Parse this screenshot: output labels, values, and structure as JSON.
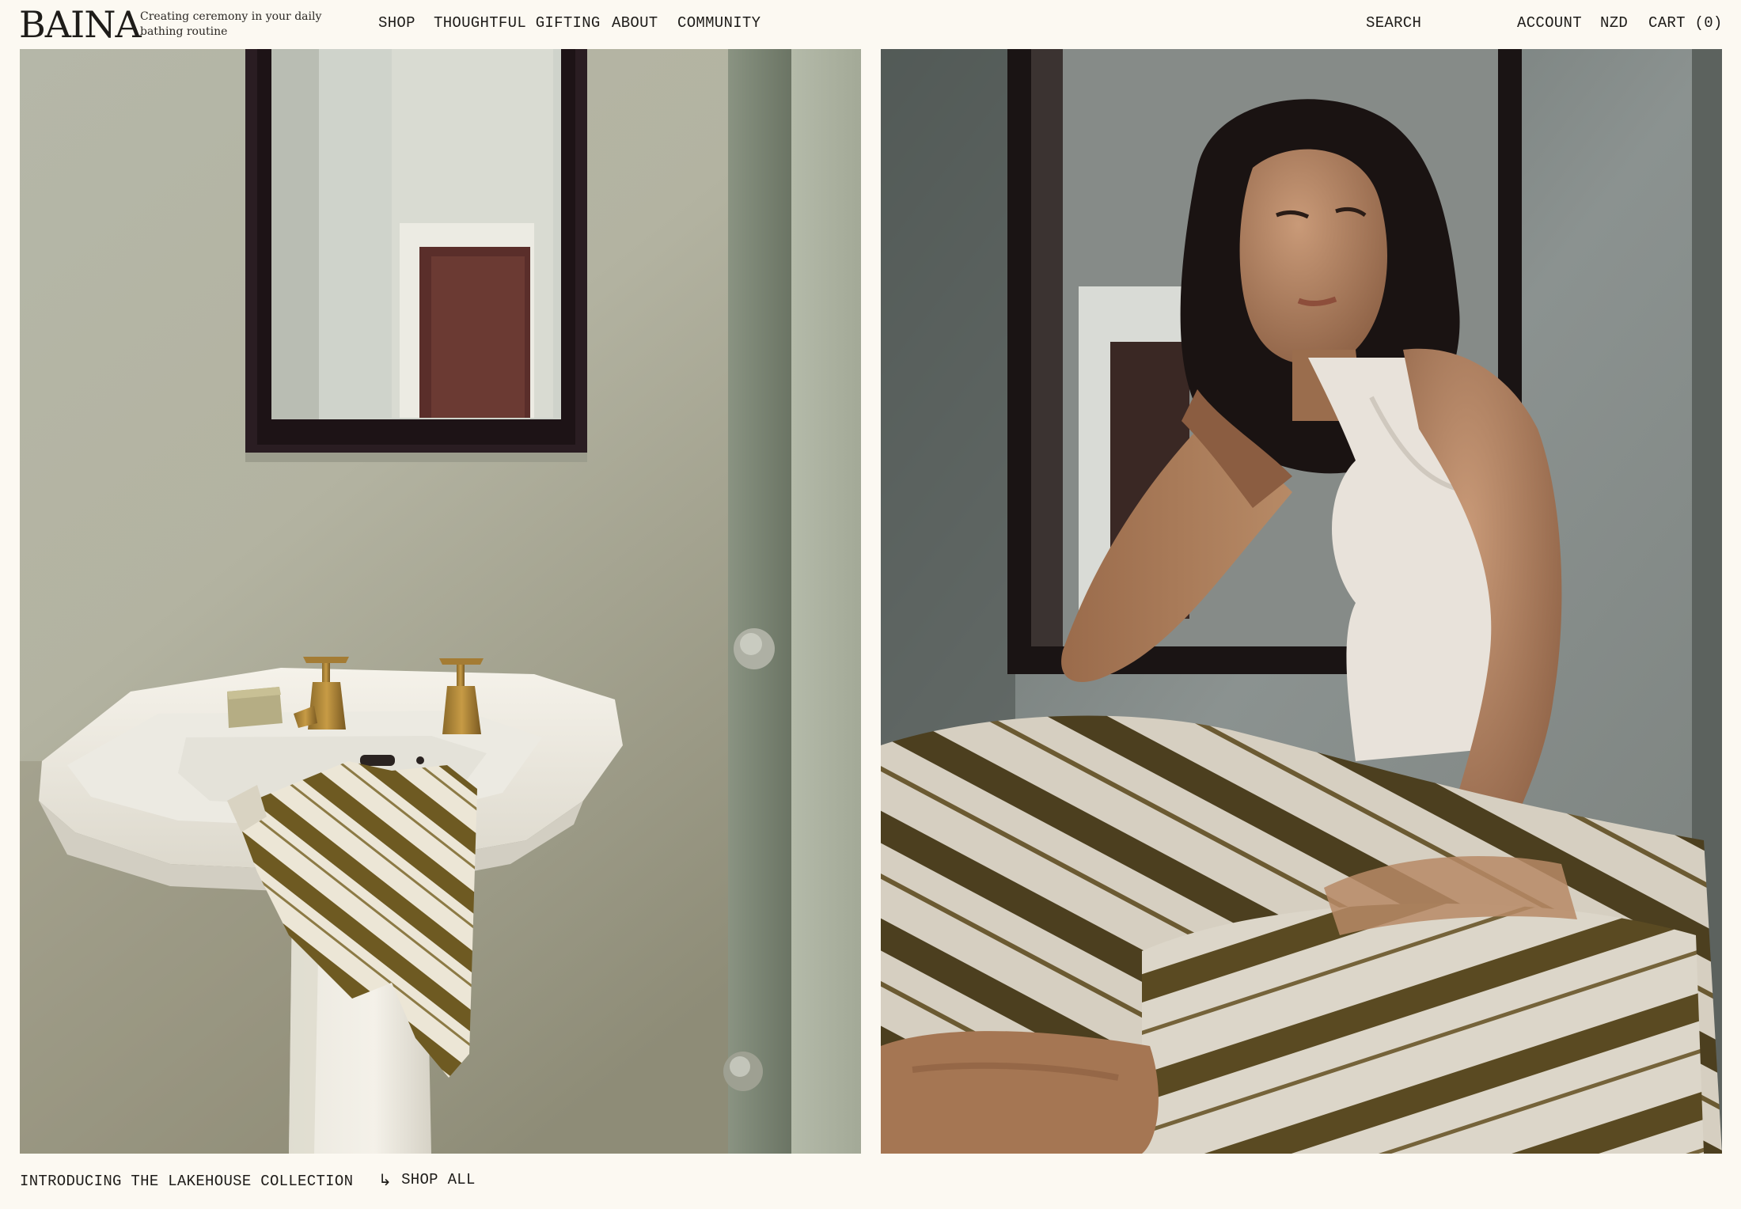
{
  "brand": {
    "logo": "BAINA",
    "tagline": "Creating ceremony in your daily bathing routine"
  },
  "nav": {
    "left": [
      "SHOP",
      "THOUGHTFUL GIFTING",
      "ABOUT",
      "COMMUNITY"
    ],
    "search": "SEARCH",
    "account": "ACCOUNT",
    "currency": "NZD",
    "cart": "CART (0)"
  },
  "hero": {
    "caption": "INTRODUCING THE LAKEHOUSE COLLECTION",
    "cta_label": "SHOP ALL",
    "cta_icon": "return-arrow-icon"
  },
  "colors": {
    "background": "#fcf9f2",
    "text": "#1e1c19",
    "towel_stripe": "#6b5a24"
  }
}
